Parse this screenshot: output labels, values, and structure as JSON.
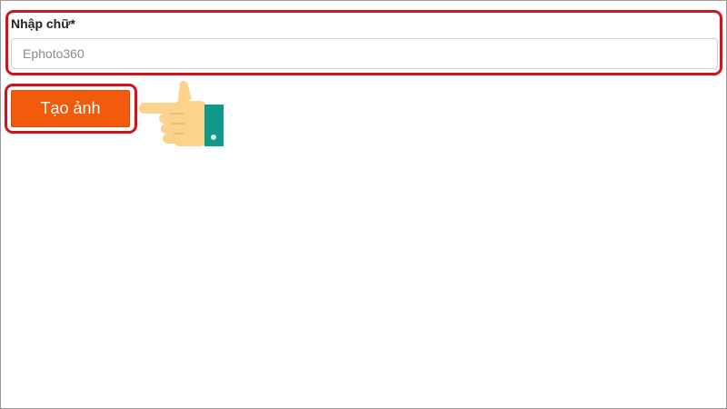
{
  "form": {
    "label": "Nhập chữ*",
    "input_value": "",
    "input_placeholder": "Ephoto360",
    "submit_label": "Tạo ảnh"
  },
  "icons": {
    "pointer": "pointing-hand-icon"
  },
  "colors": {
    "highlight_outline": "#d0131c",
    "button_background": "#f25a0c",
    "button_text": "#ffffff",
    "hand_skin": "#fcd38d",
    "cuff": "#0f9a89"
  }
}
